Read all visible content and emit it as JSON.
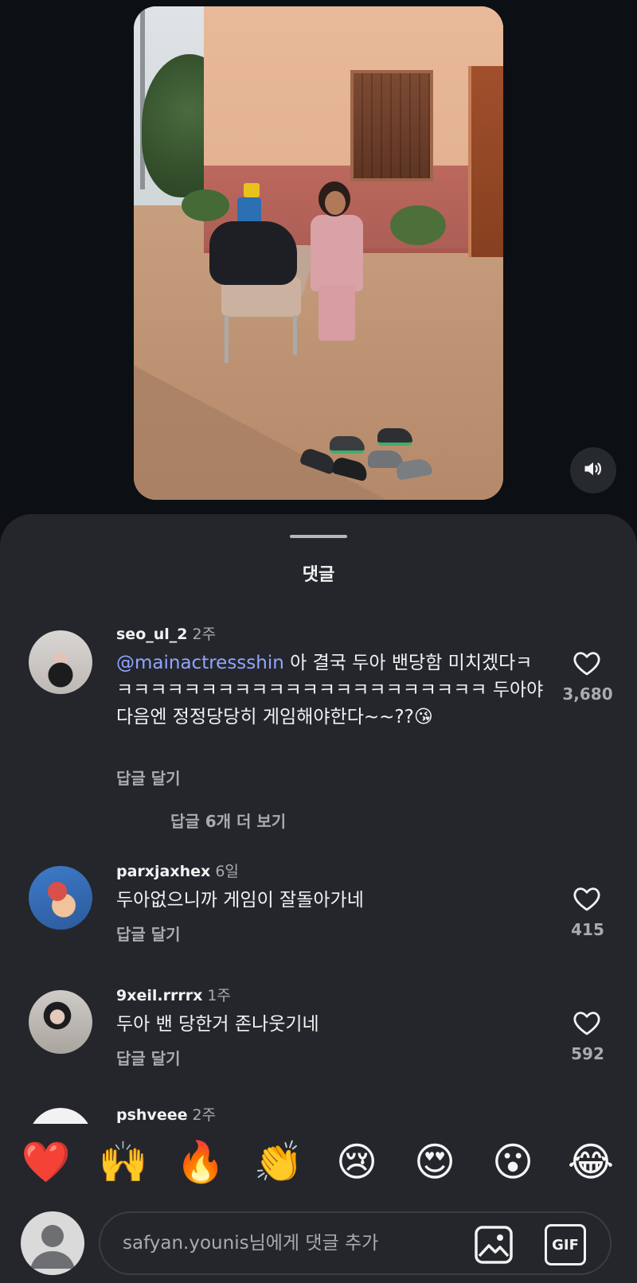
{
  "sheet": {
    "title": "댓글"
  },
  "comments": [
    {
      "username": "seo_ul_2",
      "time": "2주",
      "mention": "@mainactressshin",
      "text": " 아 결국 두아 밴당함 미치겠다ㅋㅋㅋㅋㅋㅋㅋㅋㅋㅋㅋㅋㅋㅋㅋㅋㅋㅋㅋㅋㅋㅋㅋ 두아야 다음엔 정정당당히 게임해야한다~~??😘",
      "reply_label": "답글 달기",
      "likes": "3,680"
    },
    {
      "username": "parxjaxhex",
      "time": "6일",
      "text": "두아없으니까 게임이 잘돌아가네",
      "reply_label": "답글 달기",
      "likes": "415"
    },
    {
      "username": "9xeil.rrrrx",
      "time": "1주",
      "text": "두아 밴 당한거 존나웃기네",
      "reply_label": "답글 달기",
      "likes": "592"
    },
    {
      "username": "pshveee",
      "time": "2주"
    }
  ],
  "more_replies": "답글 6개 더 보기",
  "emoji_bar": [
    "❤️",
    "🙌",
    "🔥",
    "👏",
    "😢",
    "😍",
    "😮",
    "😂"
  ],
  "input": {
    "placeholder": "safyan.younis님에게 댓글 추가",
    "gif_label": "GIF"
  },
  "icons": {
    "sound": "speaker-icon",
    "like": "heart-outline-icon",
    "image": "image-icon",
    "gif": "gif-icon"
  }
}
